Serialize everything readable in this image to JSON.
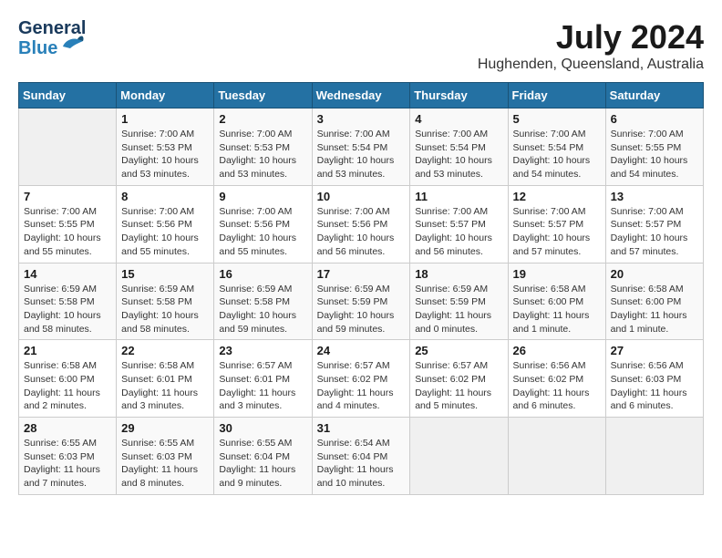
{
  "header": {
    "logo_general": "General",
    "logo_blue": "Blue",
    "month": "July 2024",
    "location": "Hughenden, Queensland, Australia"
  },
  "weekdays": [
    "Sunday",
    "Monday",
    "Tuesday",
    "Wednesday",
    "Thursday",
    "Friday",
    "Saturday"
  ],
  "weeks": [
    [
      {
        "day": "",
        "info": ""
      },
      {
        "day": "1",
        "info": "Sunrise: 7:00 AM\nSunset: 5:53 PM\nDaylight: 10 hours\nand 53 minutes."
      },
      {
        "day": "2",
        "info": "Sunrise: 7:00 AM\nSunset: 5:53 PM\nDaylight: 10 hours\nand 53 minutes."
      },
      {
        "day": "3",
        "info": "Sunrise: 7:00 AM\nSunset: 5:54 PM\nDaylight: 10 hours\nand 53 minutes."
      },
      {
        "day": "4",
        "info": "Sunrise: 7:00 AM\nSunset: 5:54 PM\nDaylight: 10 hours\nand 53 minutes."
      },
      {
        "day": "5",
        "info": "Sunrise: 7:00 AM\nSunset: 5:54 PM\nDaylight: 10 hours\nand 54 minutes."
      },
      {
        "day": "6",
        "info": "Sunrise: 7:00 AM\nSunset: 5:55 PM\nDaylight: 10 hours\nand 54 minutes."
      }
    ],
    [
      {
        "day": "7",
        "info": "Sunrise: 7:00 AM\nSunset: 5:55 PM\nDaylight: 10 hours\nand 55 minutes."
      },
      {
        "day": "8",
        "info": "Sunrise: 7:00 AM\nSunset: 5:56 PM\nDaylight: 10 hours\nand 55 minutes."
      },
      {
        "day": "9",
        "info": "Sunrise: 7:00 AM\nSunset: 5:56 PM\nDaylight: 10 hours\nand 55 minutes."
      },
      {
        "day": "10",
        "info": "Sunrise: 7:00 AM\nSunset: 5:56 PM\nDaylight: 10 hours\nand 56 minutes."
      },
      {
        "day": "11",
        "info": "Sunrise: 7:00 AM\nSunset: 5:57 PM\nDaylight: 10 hours\nand 56 minutes."
      },
      {
        "day": "12",
        "info": "Sunrise: 7:00 AM\nSunset: 5:57 PM\nDaylight: 10 hours\nand 57 minutes."
      },
      {
        "day": "13",
        "info": "Sunrise: 7:00 AM\nSunset: 5:57 PM\nDaylight: 10 hours\nand 57 minutes."
      }
    ],
    [
      {
        "day": "14",
        "info": "Sunrise: 6:59 AM\nSunset: 5:58 PM\nDaylight: 10 hours\nand 58 minutes."
      },
      {
        "day": "15",
        "info": "Sunrise: 6:59 AM\nSunset: 5:58 PM\nDaylight: 10 hours\nand 58 minutes."
      },
      {
        "day": "16",
        "info": "Sunrise: 6:59 AM\nSunset: 5:58 PM\nDaylight: 10 hours\nand 59 minutes."
      },
      {
        "day": "17",
        "info": "Sunrise: 6:59 AM\nSunset: 5:59 PM\nDaylight: 10 hours\nand 59 minutes."
      },
      {
        "day": "18",
        "info": "Sunrise: 6:59 AM\nSunset: 5:59 PM\nDaylight: 11 hours\nand 0 minutes."
      },
      {
        "day": "19",
        "info": "Sunrise: 6:58 AM\nSunset: 6:00 PM\nDaylight: 11 hours\nand 1 minute."
      },
      {
        "day": "20",
        "info": "Sunrise: 6:58 AM\nSunset: 6:00 PM\nDaylight: 11 hours\nand 1 minute."
      }
    ],
    [
      {
        "day": "21",
        "info": "Sunrise: 6:58 AM\nSunset: 6:00 PM\nDaylight: 11 hours\nand 2 minutes."
      },
      {
        "day": "22",
        "info": "Sunrise: 6:58 AM\nSunset: 6:01 PM\nDaylight: 11 hours\nand 3 minutes."
      },
      {
        "day": "23",
        "info": "Sunrise: 6:57 AM\nSunset: 6:01 PM\nDaylight: 11 hours\nand 3 minutes."
      },
      {
        "day": "24",
        "info": "Sunrise: 6:57 AM\nSunset: 6:02 PM\nDaylight: 11 hours\nand 4 minutes."
      },
      {
        "day": "25",
        "info": "Sunrise: 6:57 AM\nSunset: 6:02 PM\nDaylight: 11 hours\nand 5 minutes."
      },
      {
        "day": "26",
        "info": "Sunrise: 6:56 AM\nSunset: 6:02 PM\nDaylight: 11 hours\nand 6 minutes."
      },
      {
        "day": "27",
        "info": "Sunrise: 6:56 AM\nSunset: 6:03 PM\nDaylight: 11 hours\nand 6 minutes."
      }
    ],
    [
      {
        "day": "28",
        "info": "Sunrise: 6:55 AM\nSunset: 6:03 PM\nDaylight: 11 hours\nand 7 minutes."
      },
      {
        "day": "29",
        "info": "Sunrise: 6:55 AM\nSunset: 6:03 PM\nDaylight: 11 hours\nand 8 minutes."
      },
      {
        "day": "30",
        "info": "Sunrise: 6:55 AM\nSunset: 6:04 PM\nDaylight: 11 hours\nand 9 minutes."
      },
      {
        "day": "31",
        "info": "Sunrise: 6:54 AM\nSunset: 6:04 PM\nDaylight: 11 hours\nand 10 minutes."
      },
      {
        "day": "",
        "info": ""
      },
      {
        "day": "",
        "info": ""
      },
      {
        "day": "",
        "info": ""
      }
    ]
  ]
}
